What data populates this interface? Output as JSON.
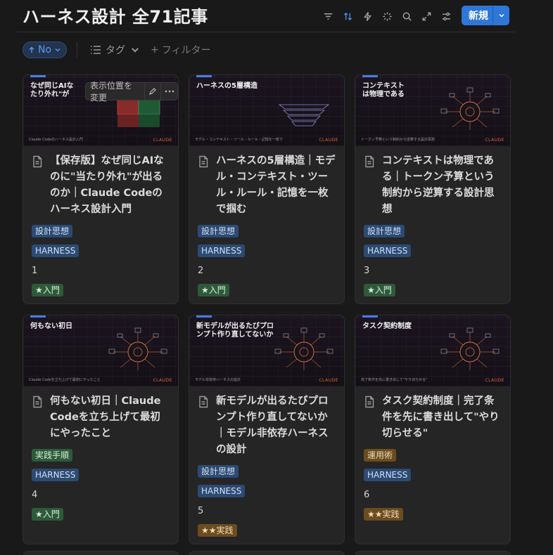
{
  "header": {
    "title": "ハーネス設計 全71記事",
    "toolbar": [
      {
        "icon": "filter-icon",
        "active": false
      },
      {
        "icon": "sort-icon",
        "active": true
      },
      {
        "icon": "lightning-icon",
        "active": false
      },
      {
        "icon": "sparkle-icon",
        "active": false
      },
      {
        "icon": "search-icon",
        "active": false
      },
      {
        "icon": "expand-icon",
        "active": false
      },
      {
        "icon": "settings-icon",
        "active": false
      }
    ],
    "new_label": "新規"
  },
  "filters": {
    "sort_label": "No",
    "tag_label": "タグ",
    "add_filter_label": "フィルター"
  },
  "hover_tools": {
    "reposition_label": "表示位置を変更"
  },
  "cards": [
    {
      "thumb_title": "なぜ同じAIな\nたり外れ\"が",
      "thumb_caption": "Claude Codeのハーネス設計入門",
      "thumb_brand": "CLAUDE",
      "title": "【保存版】なぜ同じAIなのに\"当たり外れ\"が出るのか｜Claude Codeのハーネス設計入門",
      "category": "設計思想",
      "category_color": "blue",
      "series": "HARNESS",
      "number": "1",
      "level": "★入門",
      "level_color": "green"
    },
    {
      "thumb_title": "ハーネスの5層構造",
      "thumb_caption": "モデル・コンテキスト・ツール・ルール・記憶を一枚で",
      "thumb_brand": "CLAUDE",
      "title": "ハーネスの5層構造｜モデル・コンテキスト・ツール・ルール・記憶を一枚で掴む",
      "category": "設計思想",
      "category_color": "blue",
      "series": "HARNESS",
      "number": "2",
      "level": "★入門",
      "level_color": "green"
    },
    {
      "thumb_title": "コンテキスト\nは物理である",
      "thumb_caption": "トークン予算という制約から逆算する設計思想",
      "thumb_brand": "CLAUDE",
      "title": "コンテキストは物理である｜トークン予算という制約から逆算する設計思想",
      "category": "設計思想",
      "category_color": "blue",
      "series": "HARNESS",
      "number": "3",
      "level": "★入門",
      "level_color": "green"
    },
    {
      "thumb_title": "何もない初日",
      "thumb_caption": "Claude Codeを立ち上げて最初にやったこと",
      "thumb_brand": "CLAUDE",
      "title": "何もない初日｜Claude Codeを立ち上げて最初にやったこと",
      "category": "実践手順",
      "category_color": "green",
      "series": "HARNESS",
      "number": "4",
      "level": "★入門",
      "level_color": "green"
    },
    {
      "thumb_title": "新モデルが出るたびプロ\nンプト作り直してないか",
      "thumb_caption": "モデル非依存ハーネスの設計",
      "thumb_brand": "CLAUDE",
      "title": "新モデルが出るたびプロンプト作り直してないか｜モデル非依存ハーネスの設計",
      "category": "設計思想",
      "category_color": "blue",
      "series": "HARNESS",
      "number": "5",
      "level": "★★実践",
      "level_color": "brown"
    },
    {
      "thumb_title": "タスク契約制度",
      "thumb_caption": "完了条件を先に書き出して\"やり切らせる\"",
      "thumb_brand": "CLAUDE",
      "title": "タスク契約制度｜完了条件を先に書き出して\"やり切らせる\"",
      "category": "運用術",
      "category_color": "brown",
      "series": "HARNESS",
      "number": "6",
      "level": "★★実践",
      "level_color": "brown"
    }
  ]
}
